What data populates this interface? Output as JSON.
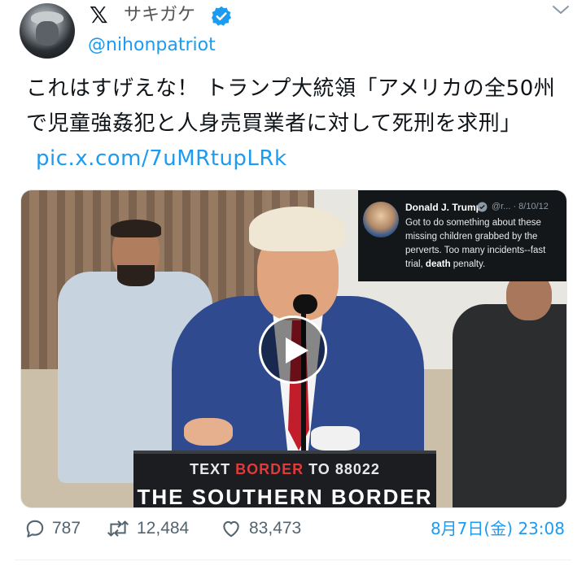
{
  "account": {
    "display_name": "サキガケ",
    "handle": "@nihonpatriot"
  },
  "tweet": {
    "text": "これはすげえな！ トランプ大統領「アメリカの全50州で児童強姦犯と人身売買業者に対して死刑を求刑」",
    "link": "pic.x.com/7uMRtupLRk"
  },
  "media": {
    "podium_line1_prefix": "TEXT ",
    "podium_line1_red": "BORDER",
    "podium_line1_suffix": " TO 88022",
    "podium_line2": "THE SOUTHERN BORDER",
    "quoted_post": {
      "author": "Donald J. Trump",
      "meta": "@r... · 8/10/12",
      "text_before_bold1": "Got to do something about these missing children grabbed by the perverts. Too many incidents--fast trial, ",
      "bold": "death",
      "text_after_bold": " penalty."
    }
  },
  "stats": {
    "replies": "787",
    "reposts": "12,484",
    "likes": "83,473"
  },
  "timestamp": "8月7日(金) 23:08",
  "colors": {
    "accent": "#1d9bf0",
    "muted": "#536471",
    "tie": "#c21d2a",
    "suit": "#2f4a8f"
  },
  "icons": {
    "logo": "x-logo-icon",
    "verified": "verified-badge-icon",
    "menu": "chevron-down-icon",
    "play": "play-icon",
    "reply": "reply-icon",
    "repost": "repost-icon",
    "like": "heart-icon"
  }
}
